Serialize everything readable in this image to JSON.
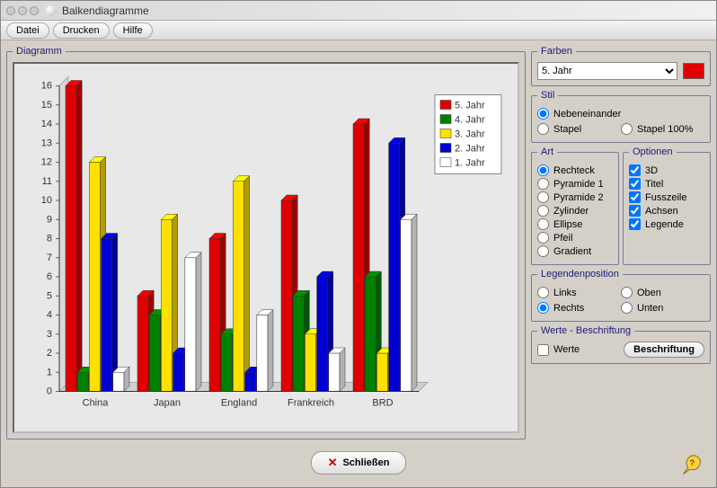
{
  "window": {
    "title": "Balkendiagramme"
  },
  "menu": {
    "file": "Datei",
    "print": "Drucken",
    "help": "Hilfe"
  },
  "panels": {
    "diagram": "Diagramm",
    "colors": "Farben",
    "style": "Stil",
    "kind": "Art",
    "options": "Optionen",
    "legendpos": "Legendenposition",
    "values": "Werte - Beschriftung"
  },
  "colors": {
    "selected": "5. Jahr",
    "swatch": "#e00000"
  },
  "style": {
    "side": "Nebeneinander",
    "stack": "Stapel",
    "stack100": "Stapel 100%"
  },
  "kind": {
    "rect": "Rechteck",
    "pyr1": "Pyramide 1",
    "pyr2": "Pyramide 2",
    "cyl": "Zylinder",
    "ell": "Ellipse",
    "arrow": "Pfeil",
    "grad": "Gradient"
  },
  "options": {
    "d3": "3D",
    "title": "Titel",
    "footer": "Fusszeile",
    "axes": "Achsen",
    "legend": "Legende"
  },
  "legendpos": {
    "left": "Links",
    "right": "Rechts",
    "top": "Oben",
    "bottom": "Unten"
  },
  "values": {
    "werte": "Werte",
    "beschriftung": "Beschriftung"
  },
  "buttons": {
    "close": "Schließen"
  },
  "chart_data": {
    "type": "bar",
    "categories": [
      "China",
      "Japan",
      "England",
      "Frankreich",
      "BRD"
    ],
    "series": [
      {
        "name": "5. Jahr",
        "color": "#e00000",
        "values": [
          16,
          5,
          8,
          10,
          14
        ]
      },
      {
        "name": "4. Jahr",
        "color": "#008000",
        "values": [
          1,
          4,
          3,
          5,
          6
        ]
      },
      {
        "name": "3. Jahr",
        "color": "#ffe000",
        "values": [
          12,
          9,
          11,
          3,
          2
        ]
      },
      {
        "name": "2. Jahr",
        "color": "#0000d0",
        "values": [
          8,
          2,
          1,
          6,
          13
        ]
      },
      {
        "name": "1. Jahr",
        "color": "#ffffff",
        "values": [
          1,
          7,
          4,
          2,
          9
        ]
      }
    ],
    "ylim": [
      0,
      16
    ],
    "yticks": [
      0,
      1,
      2,
      3,
      4,
      5,
      6,
      7,
      8,
      9,
      10,
      11,
      12,
      13,
      14,
      15,
      16
    ],
    "xlabel": "",
    "ylabel": "",
    "title": ""
  }
}
